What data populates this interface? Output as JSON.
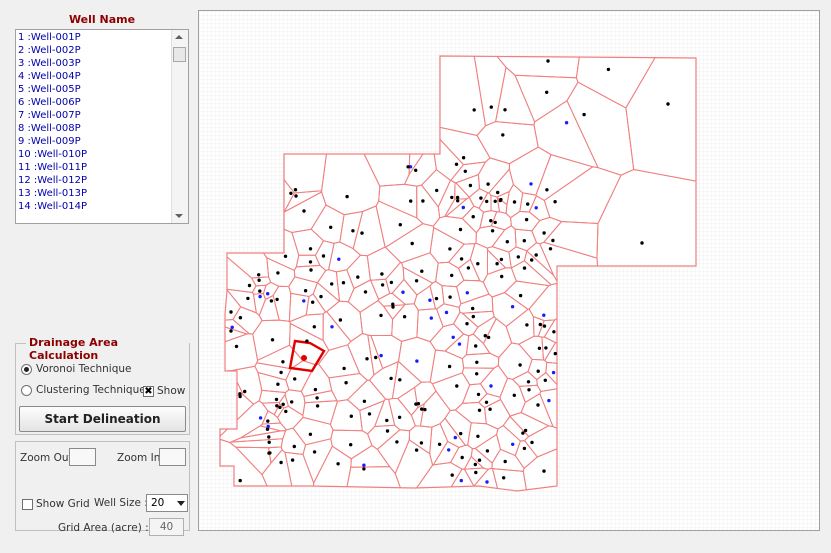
{
  "well_panel": {
    "title": "Well Name",
    "items": [
      "1 :Well-001P",
      "2 :Well-002P",
      "3 :Well-003P",
      "4 :Well-004P",
      "5 :Well-005P",
      "6 :Well-006P",
      "7 :Well-007P",
      "8 :Well-008P",
      "9 :Well-009P",
      "10 :Well-010P",
      "11 :Well-011P",
      "12 :Well-012P",
      "13 :Well-013P",
      "14 :Well-014P"
    ]
  },
  "drainage": {
    "title": "Drainage Area Calculation",
    "voronoi_label": "Voronoi Technique",
    "voronoi_selected": true,
    "clustering_label": "Clustering Technique",
    "clustering_selected": false,
    "show_label": "Show",
    "show_checked": true,
    "show_mark": "✖",
    "start_button": "Start Delineation"
  },
  "zoom": {
    "zoom_out_label": "Zoom Out",
    "zoom_in_label": "Zoom In",
    "show_grid_label": "Show Grid",
    "show_grid_checked": false,
    "well_size_label": "Well Size :",
    "well_size_value": "20",
    "grid_area_label": "Grid Area (acre) :",
    "grid_area_value": "40"
  },
  "map": {
    "boundary_color": "#f08080",
    "selected_color": "#e00000",
    "well_color": "#000000",
    "injector_color": "#1a1aff"
  }
}
